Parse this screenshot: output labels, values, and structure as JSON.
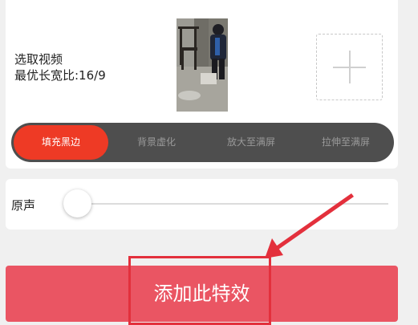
{
  "video_section": {
    "label_line1": "选取视频",
    "label_line2": "最优长宽比:16/9"
  },
  "modes": [
    {
      "label": "填充黑边",
      "active": true
    },
    {
      "label": "背景虚化",
      "active": false
    },
    {
      "label": "放大至满屏",
      "active": false
    },
    {
      "label": "拉伸至满屏",
      "active": false
    }
  ],
  "audio": {
    "label": "原声",
    "level": 0
  },
  "action": {
    "label": "添加此特效"
  },
  "colors": {
    "accent": "#ee3a25",
    "action_button": "#ea5563",
    "annotation": "#e3303c",
    "mode_bar": "#4e4e4e"
  },
  "icons": {
    "add": "plus-icon"
  }
}
